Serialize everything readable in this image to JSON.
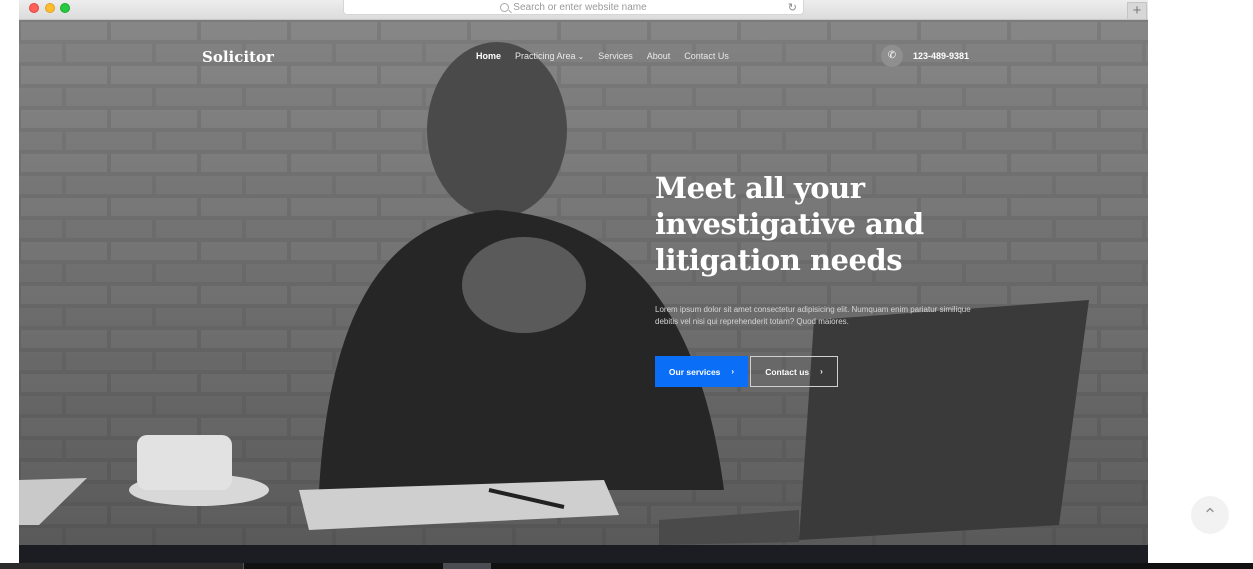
{
  "browser": {
    "address_placeholder": "Search or enter website name",
    "reload_glyph": "↻",
    "new_tab_glyph": "+"
  },
  "site": {
    "logo": "Solicitor",
    "nav": [
      {
        "label": "Home",
        "active": true
      },
      {
        "label": "Practicing Area",
        "has_dropdown": true
      },
      {
        "label": "Services"
      },
      {
        "label": "About"
      },
      {
        "label": "Contact Us"
      }
    ],
    "phone": "123-489-9381",
    "phone_icon": "phone-icon"
  },
  "hero": {
    "headline": "Meet all your investigative and litigation needs",
    "subtext": "Lorem ipsum dolor sit amet consectetur adipisicing elit. Numquam enim pariatur similique debitis vel nisi qui reprehenderit totam? Quod maiores.",
    "primary_button": "Our services",
    "secondary_button": "Contact us",
    "arrow_glyph": "›"
  },
  "colors": {
    "accent": "#0a6ef7",
    "overlay": "#2a2a2a"
  },
  "scroll_top_glyph": "⌃"
}
